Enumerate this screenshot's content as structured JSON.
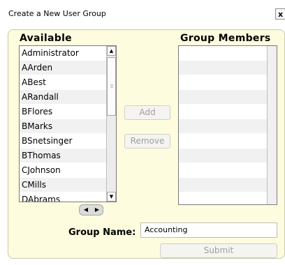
{
  "dialog": {
    "title": "Create a New User Group",
    "close_label": "x"
  },
  "available": {
    "header": "Available",
    "items": [
      "Administrator",
      "AArden",
      "ABest",
      "ARandall",
      "BFlores",
      "BMarks",
      "BSnetsinger",
      "BThomas",
      "CJohnson",
      "CMills",
      "DAbrams"
    ]
  },
  "members": {
    "header": "Group Members",
    "items": []
  },
  "buttons": {
    "add": "Add",
    "remove": "Remove",
    "submit": "Submit"
  },
  "group_name": {
    "label": "Group Name:",
    "value": "Accounting"
  },
  "icons": {
    "scroll_up": "scroll-up-arrow-icon",
    "scroll_down": "scroll-down-arrow-icon",
    "scroll_left": "scroll-left-arrow-icon",
    "scroll_right": "scroll-right-arrow-icon",
    "close": "close-icon"
  }
}
